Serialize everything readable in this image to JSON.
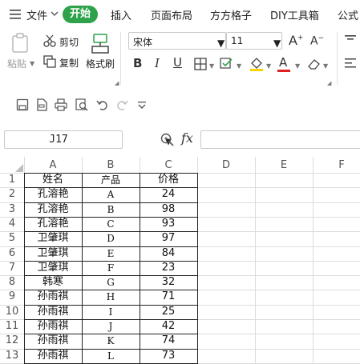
{
  "menu": {
    "file_label": "文件",
    "tabs": [
      "开始",
      "插入",
      "页面布局",
      "方方格子",
      "DIY工具箱",
      "公式"
    ]
  },
  "ribbon": {
    "paste_label": "粘贴",
    "cut_label": "剪切",
    "copy_label": "复制",
    "format_painter_label": "格式刷",
    "font_name": "宋体",
    "font_size": "11",
    "bold": "B",
    "italic": "I",
    "underline": "U",
    "grow_font": "A",
    "shrink_font": "A",
    "font_color_letter": "A",
    "font_color": "#e02020",
    "highlight_color": "#f5d400"
  },
  "formula_bar": {
    "cell_ref": "J17",
    "fx": "fx",
    "value": ""
  },
  "sheet": {
    "columns": [
      "A",
      "B",
      "C",
      "D",
      "E",
      "F"
    ],
    "row_numbers": [
      "1",
      "2",
      "3",
      "4",
      "5",
      "6",
      "7",
      "8",
      "9",
      "10",
      "11",
      "12",
      "13"
    ],
    "headers": [
      "姓名",
      "产品",
      "价格"
    ],
    "rows": [
      [
        "孔溶艳",
        "A",
        "24"
      ],
      [
        "孔溶艳",
        "B",
        "98"
      ],
      [
        "孔溶艳",
        "C",
        "93"
      ],
      [
        "卫肇琪",
        "D",
        "97"
      ],
      [
        "卫肇琪",
        "E",
        "84"
      ],
      [
        "卫肇琪",
        "F",
        "23"
      ],
      [
        "韩寒",
        "G",
        "32"
      ],
      [
        "孙雨祺",
        "H",
        "71"
      ],
      [
        "孙雨祺",
        "I",
        "25"
      ],
      [
        "孙雨祺",
        "J",
        "42"
      ],
      [
        "孙雨祺",
        "K",
        "74"
      ],
      [
        "孙雨祺",
        "L",
        "73"
      ]
    ]
  },
  "colors": {
    "accent": "#2da24a",
    "grid_line": "#dcdcdc",
    "table_border": "#222222"
  }
}
